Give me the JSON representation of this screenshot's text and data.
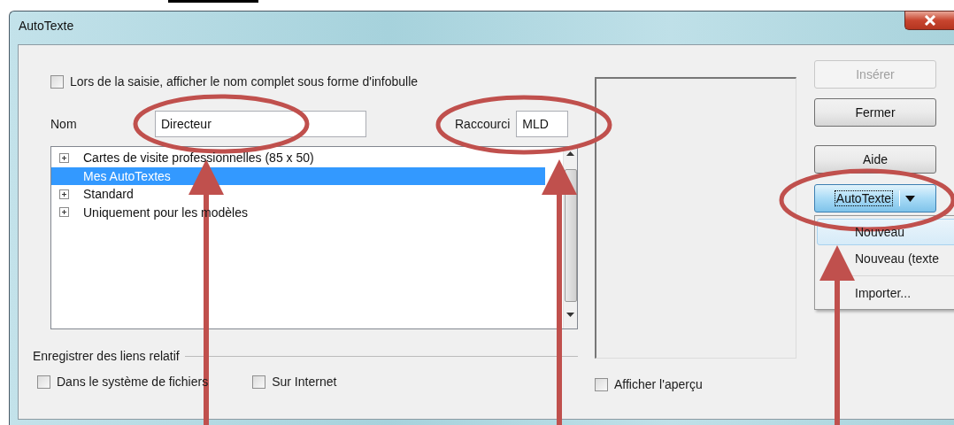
{
  "window": {
    "title": "AutoTexte"
  },
  "tooltip_option": {
    "label": "Lors de la saisie, afficher le nom complet sous forme d'infobulle",
    "checked": false
  },
  "name_field": {
    "label": "Nom",
    "value": "Directeur"
  },
  "shortcut_field": {
    "label": "Raccourci",
    "value": "MLD"
  },
  "tree": [
    {
      "label": "Cartes de visite professionnelles (85 x 50)",
      "expandable": true,
      "selected": false
    },
    {
      "label": "Mes AutoTextes",
      "expandable": false,
      "selected": true
    },
    {
      "label": "Standard",
      "expandable": true,
      "selected": false
    },
    {
      "label": "Uniquement pour les modèles",
      "expandable": true,
      "selected": false
    }
  ],
  "relative_links": {
    "title": "Enregistrer des liens relatif",
    "options": [
      {
        "label": "Dans le système de fichiers",
        "checked": false
      },
      {
        "label": "Sur Internet",
        "checked": false
      }
    ]
  },
  "preview_option": {
    "label": "Afficher l'aperçu",
    "checked": false
  },
  "buttons": [
    {
      "label": "Insérer",
      "kind": "push",
      "disabled": true
    },
    {
      "label": "Fermer",
      "kind": "push",
      "disabled": false
    },
    {
      "label": "Aide",
      "kind": "push",
      "disabled": false
    },
    {
      "label": "AutoTexte",
      "kind": "split",
      "disabled": false
    }
  ],
  "menu": [
    {
      "label": "Nouveau",
      "selected": true,
      "separator_before": false
    },
    {
      "label": "Nouveau (texte",
      "selected": false,
      "separator_before": false
    },
    {
      "label": "Importer...",
      "selected": false,
      "separator_before": true
    }
  ]
}
